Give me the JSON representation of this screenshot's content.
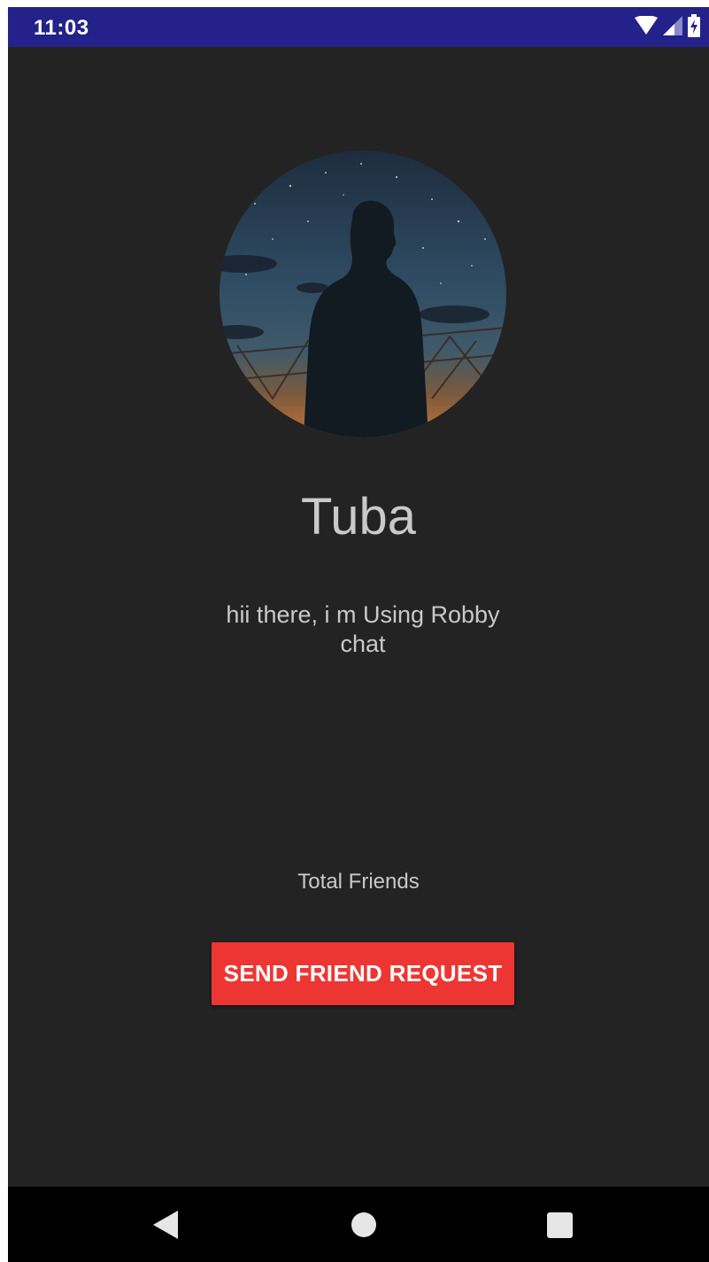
{
  "status_bar": {
    "time": "11:03",
    "icons": [
      "wifi-icon",
      "signal-icon",
      "battery-charging-icon"
    ]
  },
  "profile": {
    "avatar": "profile-photo",
    "name": "Tuba",
    "status_text": "hii there, i m Using Robby chat",
    "friends_label": "Total Friends"
  },
  "actions": {
    "send_request_label": "SEND FRIEND REQUEST"
  },
  "navigation": {
    "buttons": [
      "back-icon",
      "home-icon",
      "recents-icon"
    ]
  },
  "colors": {
    "status_bar": "#24228a",
    "background": "#232323",
    "text": "#c9c9c9",
    "accent_button": "#ed3634",
    "nav_bar": "#000000"
  }
}
